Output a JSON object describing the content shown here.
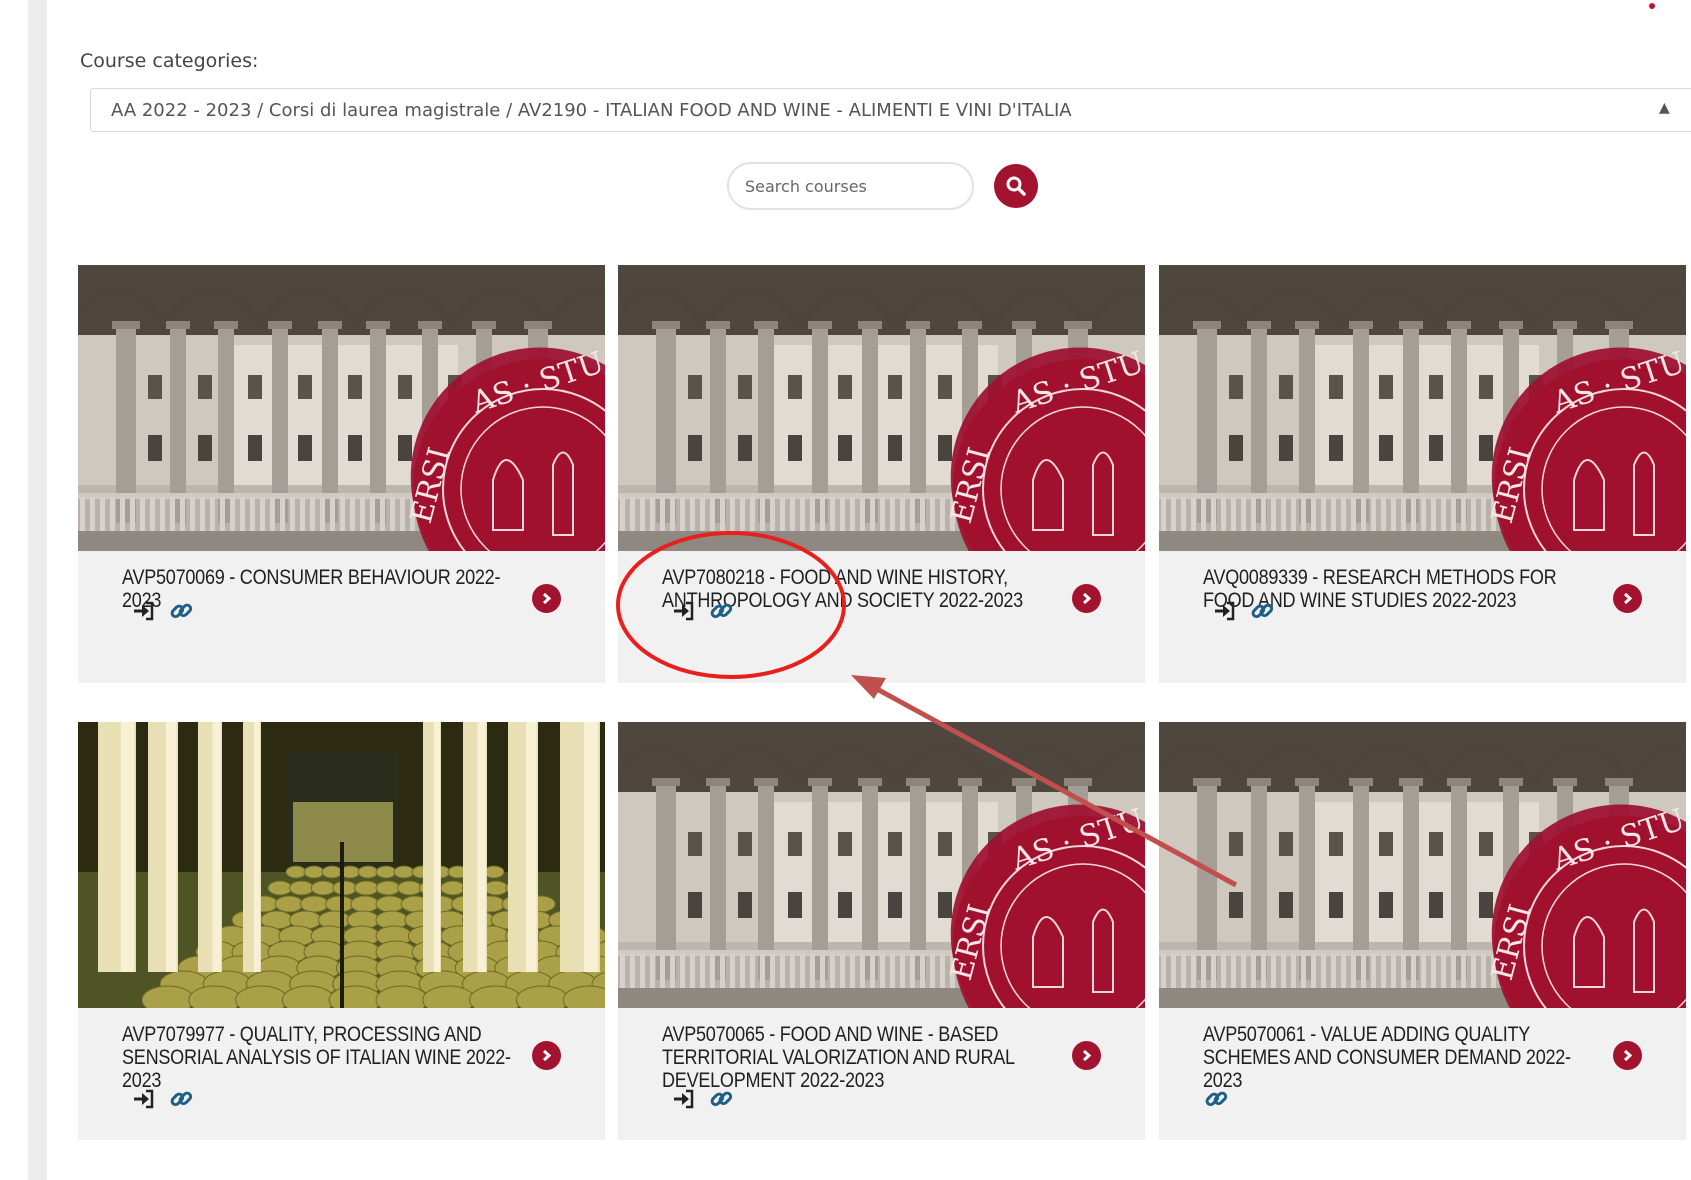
{
  "filter": {
    "label": "Course categories:",
    "selected_category": "AA 2022 - 2023 / Corsi di laurea magistrale / AV2190 - ITALIAN FOOD AND WINE - ALIMENTI E VINI D'ITALIA"
  },
  "search": {
    "placeholder": "Search courses",
    "icon": "search-icon"
  },
  "colors": {
    "accent": "#a3122e",
    "card_background": "#f1f1f1",
    "annotation_circle": "#e8201d",
    "annotation_arrow": "#c0504d"
  },
  "courses": [
    {
      "title": "AVP5070069 - CONSUMER BEHAVIOUR 2022-2023",
      "image": "university-courtyard-seal",
      "icons": [
        "enrol-icon",
        "guest-access-icon"
      ]
    },
    {
      "title": "AVP7080218 - FOOD AND WINE HISTORY, ANTHROPOLOGY AND SOCIETY 2022-2023",
      "image": "university-courtyard-seal",
      "icons": [
        "enrol-icon",
        "guest-access-icon"
      ],
      "highlighted": true
    },
    {
      "title": "AVQ0089339 - RESEARCH METHODS FOR FOOD AND WINE STUDIES 2022-2023",
      "image": "university-courtyard-seal",
      "icons": [
        "enrol-icon",
        "guest-access-icon"
      ]
    },
    {
      "title": "AVP7079977 - QUALITY, PROCESSING AND SENSORIAL ANALYSIS OF ITALIAN WINE 2022-2023",
      "image": "wine-cellar-barrels",
      "icons": [
        "enrol-icon",
        "guest-access-icon"
      ]
    },
    {
      "title": "AVP5070065 - FOOD AND WINE - BASED TERRITORIAL VALORIZATION AND RURAL DEVELOPMENT 2022-2023",
      "image": "university-courtyard-seal",
      "icons": [
        "enrol-icon",
        "guest-access-icon"
      ]
    },
    {
      "title": "AVP5070061 - VALUE ADDING QUALITY SCHEMES AND CONSUMER DEMAND 2022-2023",
      "image": "university-courtyard-seal",
      "icons": [
        "guest-access-icon"
      ]
    }
  ],
  "annotation": {
    "shape": "ellipse-with-arrow",
    "target": "course-card-2-icons"
  }
}
